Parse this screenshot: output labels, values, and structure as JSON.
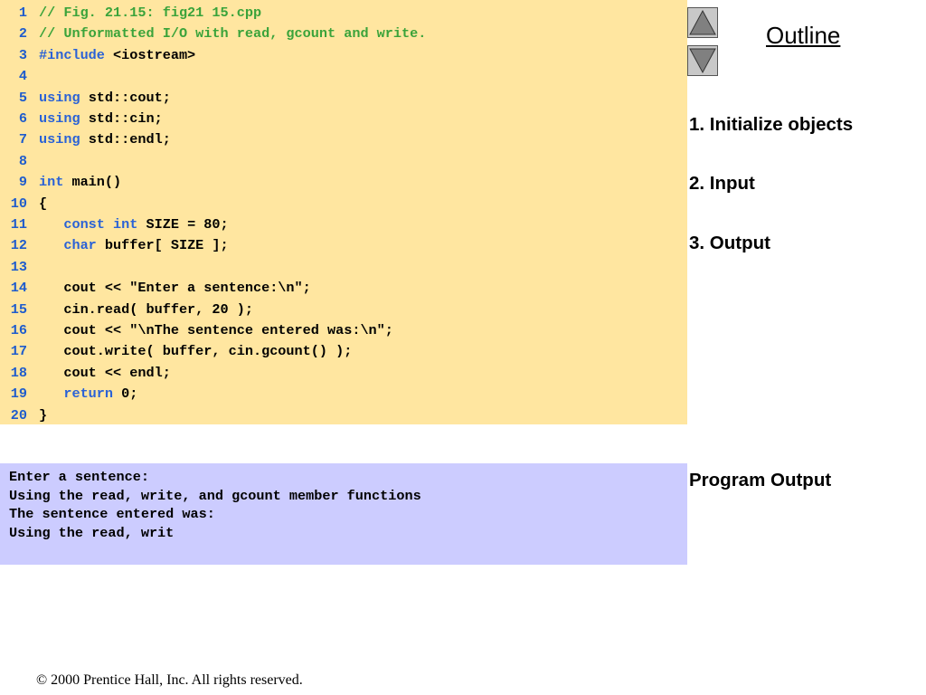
{
  "code_lines": [
    {
      "num": "1",
      "tokens": [
        {
          "t": "// Fig. 21.15: fig21 15.cpp",
          "c": "comment"
        }
      ]
    },
    {
      "num": "2",
      "tokens": [
        {
          "t": "// Unformatted I/O with read, gcount and write.",
          "c": "comment"
        }
      ]
    },
    {
      "num": "3",
      "tokens": [
        {
          "t": "#include",
          "c": "kw"
        },
        {
          "t": " <iostream>",
          "c": "text"
        }
      ]
    },
    {
      "num": "4",
      "tokens": []
    },
    {
      "num": "5",
      "tokens": [
        {
          "t": "using",
          "c": "kw"
        },
        {
          "t": " std::cout;",
          "c": "text"
        }
      ]
    },
    {
      "num": "6",
      "tokens": [
        {
          "t": "using",
          "c": "kw"
        },
        {
          "t": " std::cin;",
          "c": "text"
        }
      ]
    },
    {
      "num": "7",
      "tokens": [
        {
          "t": "using",
          "c": "kw"
        },
        {
          "t": " std::endl;",
          "c": "text"
        }
      ]
    },
    {
      "num": "8",
      "tokens": []
    },
    {
      "num": "9",
      "tokens": [
        {
          "t": "int",
          "c": "kw"
        },
        {
          "t": " main()",
          "c": "text"
        }
      ]
    },
    {
      "num": "10",
      "tokens": [
        {
          "t": "{",
          "c": "text"
        }
      ]
    },
    {
      "num": "11",
      "tokens": [
        {
          "t": "   ",
          "c": "text"
        },
        {
          "t": "const",
          "c": "kw"
        },
        {
          "t": " ",
          "c": "text"
        },
        {
          "t": "int",
          "c": "kw"
        },
        {
          "t": " SIZE = 80;",
          "c": "text"
        }
      ]
    },
    {
      "num": "12",
      "tokens": [
        {
          "t": "   ",
          "c": "text"
        },
        {
          "t": "char",
          "c": "kw"
        },
        {
          "t": " buffer[ SIZE ];",
          "c": "text"
        }
      ]
    },
    {
      "num": "13",
      "tokens": []
    },
    {
      "num": "14",
      "tokens": [
        {
          "t": "   cout << \"Enter a sentence:\\n\";",
          "c": "text"
        }
      ]
    },
    {
      "num": "15",
      "tokens": [
        {
          "t": "   cin.read( buffer, 20 );",
          "c": "text"
        }
      ]
    },
    {
      "num": "16",
      "tokens": [
        {
          "t": "   cout << \"\\nThe sentence entered was:\\n\";",
          "c": "text"
        }
      ]
    },
    {
      "num": "17",
      "tokens": [
        {
          "t": "   cout.write( buffer, cin.gcount() );",
          "c": "text"
        }
      ]
    },
    {
      "num": "18",
      "tokens": [
        {
          "t": "   cout << endl;",
          "c": "text"
        }
      ]
    },
    {
      "num": "19",
      "tokens": [
        {
          "t": "   ",
          "c": "text"
        },
        {
          "t": "return",
          "c": "kw"
        },
        {
          "t": " 0;",
          "c": "text"
        }
      ]
    },
    {
      "num": "20",
      "tokens": [
        {
          "t": "}",
          "c": "text"
        }
      ]
    }
  ],
  "program_output": [
    "Enter a sentence:",
    "Using the read, write, and gcount member functions",
    "The sentence entered was:",
    "Using the read, writ"
  ],
  "outline": {
    "title": "Outline",
    "items": [
      "1. Initialize objects",
      "2. Input",
      "3. Output"
    ],
    "output_label": "Program Output"
  },
  "nav": {
    "up_icon": "up-triangle-icon",
    "down_icon": "down-triangle-icon"
  },
  "footer": "© 2000 Prentice Hall, Inc.  All rights reserved.",
  "colors": {
    "code_bg": "#ffe6a0",
    "output_bg": "#ccccff",
    "comment": "#3aa33a",
    "keyword": "#2a62d6",
    "line_number": "#1f5ccc"
  }
}
